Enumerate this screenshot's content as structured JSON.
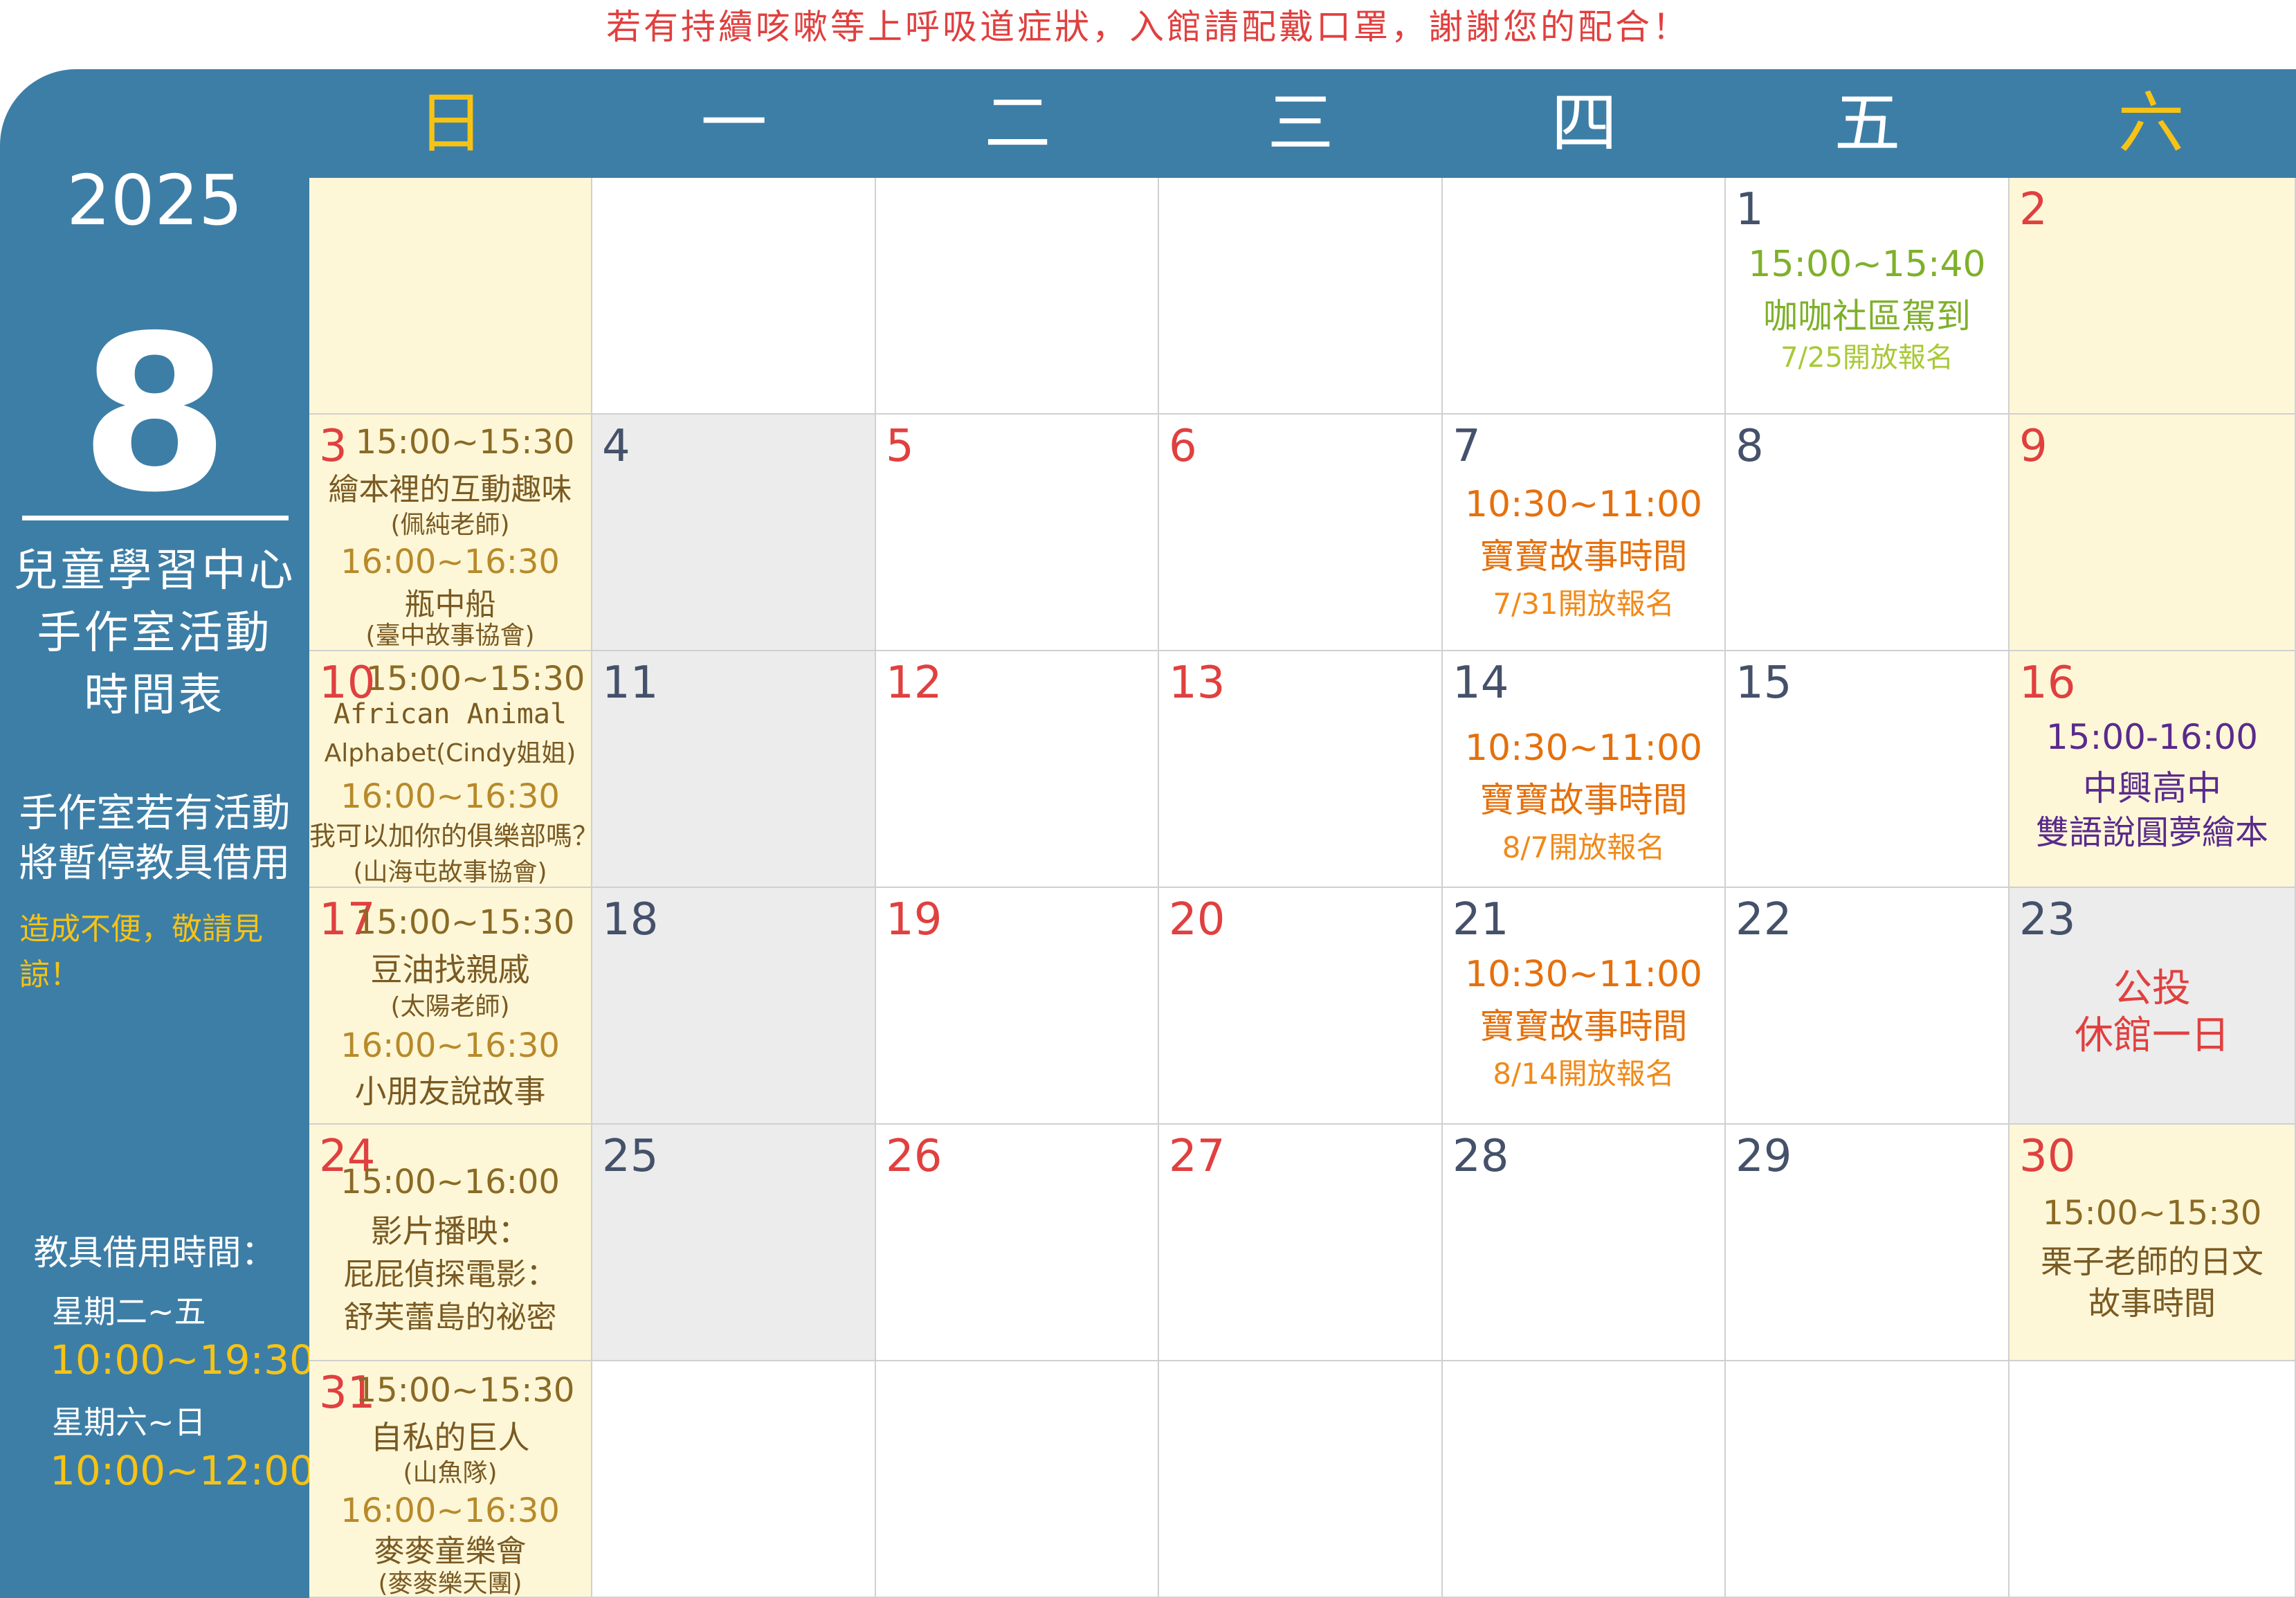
{
  "notice": "若有持續咳嗽等上呼吸道症狀，入館請配戴口罩，謝謝您的配合！",
  "sidebar": {
    "year": "2025",
    "month": "8",
    "title_lines": [
      "兒童學習中心",
      "手作室活動",
      "時間表"
    ],
    "note_lines": [
      "手作室若有活動",
      "將暫停教具借用"
    ],
    "apology_lines": [
      "造成不便，敬請見",
      "諒！"
    ],
    "hours_title": "教具借用時間：",
    "weekday_label": "星期二~五",
    "weekday_time": "10:00~19:30",
    "weekend_label": "星期六~日",
    "weekend_time": "10:00~12:00"
  },
  "weekdays": [
    "日",
    "一",
    "二",
    "三",
    "四",
    "五",
    "六"
  ],
  "colors": {
    "header_blue": "#3d7ea6",
    "weekend_yellow": "#f6c315",
    "date_red": "#e0403f",
    "date_navy": "#45516a",
    "weekend_cell_bg": "#fdf7d8",
    "closed_cell_bg": "#ececec"
  },
  "days": {
    "d1": {
      "num": "1",
      "time": "15:00~15:40",
      "title": "咖咖社區駕到",
      "note": "7/25開放報名"
    },
    "d2": {
      "num": "2"
    },
    "d3": {
      "num": "3",
      "time1": "15:00~15:30",
      "title1": "繪本裡的互動趣味",
      "note1": "(佩純老師)",
      "time2": "16:00~16:30",
      "title2": "瓶中船",
      "note2": "(臺中故事協會)"
    },
    "d4": {
      "num": "4"
    },
    "d5": {
      "num": "5"
    },
    "d6": {
      "num": "6"
    },
    "d7": {
      "num": "7",
      "time": "10:30~11:00",
      "title": "寶寶故事時間",
      "note": "7/31開放報名"
    },
    "d8": {
      "num": "8"
    },
    "d9": {
      "num": "9"
    },
    "d10": {
      "num": "10",
      "time1": "15:00~15:30",
      "title1a": "African Animal",
      "title1b": "Alphabet(Cindy姐姐)",
      "time2": "16:00~16:30",
      "title2": "我可以加你的俱樂部嗎？",
      "note2": "(山海屯故事協會)"
    },
    "d11": {
      "num": "11"
    },
    "d12": {
      "num": "12"
    },
    "d13": {
      "num": "13"
    },
    "d14": {
      "num": "14",
      "time": "10:30~11:00",
      "title": "寶寶故事時間",
      "note": "8/7開放報名"
    },
    "d15": {
      "num": "15"
    },
    "d16": {
      "num": "16",
      "time": "15:00-16:00",
      "title": "中興高中",
      "subtitle": "雙語說圓夢繪本"
    },
    "d17": {
      "num": "17",
      "time1": "15:00~15:30",
      "title1": "豆油找親戚",
      "note1": "(太陽老師)",
      "time2": "16:00~16:30",
      "title2": "小朋友說故事"
    },
    "d18": {
      "num": "18"
    },
    "d19": {
      "num": "19"
    },
    "d20": {
      "num": "20"
    },
    "d21": {
      "num": "21",
      "time": "10:30~11:00",
      "title": "寶寶故事時間",
      "note": "8/14開放報名"
    },
    "d22": {
      "num": "22"
    },
    "d23": {
      "num": "23",
      "line1": "公投",
      "line2": "休館一日"
    },
    "d24": {
      "num": "24",
      "time": "15:00~16:00",
      "line1": "影片播映：",
      "line2": "屁屁偵探電影：",
      "line3": "舒芙蕾島的祕密"
    },
    "d25": {
      "num": "25"
    },
    "d26": {
      "num": "26"
    },
    "d27": {
      "num": "27"
    },
    "d28": {
      "num": "28"
    },
    "d29": {
      "num": "29"
    },
    "d30": {
      "num": "30",
      "time": "15:00~15:30",
      "line1": "栗子老師的日文",
      "line2": "故事時間"
    },
    "d31": {
      "num": "31",
      "time1": "15:00~15:30",
      "title1": "自私的巨人",
      "note1": "(山魚隊)",
      "time2": "16:00~16:30",
      "title2": "麥麥童樂會",
      "note2": "(麥麥樂天團)"
    }
  }
}
